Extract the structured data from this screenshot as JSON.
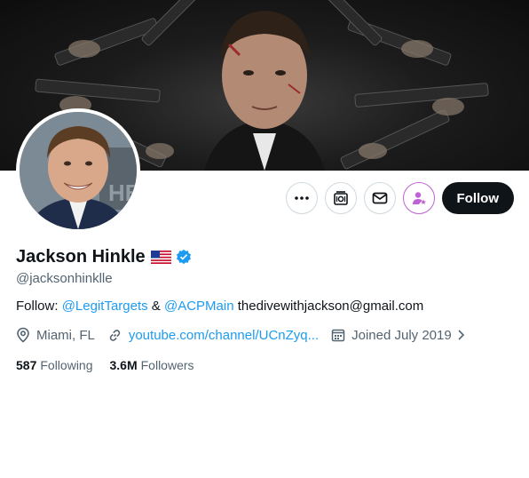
{
  "profile": {
    "display_name": "Jackson Hinkle",
    "handle": "@jacksonhinklle",
    "flag_icon": "us-flag-icon",
    "verified_icon": "verified-badge-icon",
    "bio": {
      "prefix": "Follow: ",
      "mention_1": "@LegitTargets",
      "amp": " & ",
      "mention_2": "@ACPMain",
      "email": " thedivewithjackson@gmail.com"
    },
    "location": "Miami, FL",
    "website": "youtube.com/channel/UCnZyq...",
    "joined": "Joined July 2019",
    "following": {
      "count": "587",
      "label": "Following"
    },
    "followers": {
      "count": "3.6M",
      "label": "Followers"
    }
  },
  "actions": {
    "more_icon": "more-icon",
    "subscribe_icon": "subscribe-icon",
    "message_icon": "envelope-icon",
    "notify_icon": "person-star-icon",
    "follow_label": "Follow"
  },
  "colors": {
    "link": "#1d9bf0",
    "text": "#0f1419",
    "secondary": "#536471",
    "border": "#cfd9de",
    "accent_purple": "#c062d3",
    "follow_bg": "#0f1419"
  }
}
